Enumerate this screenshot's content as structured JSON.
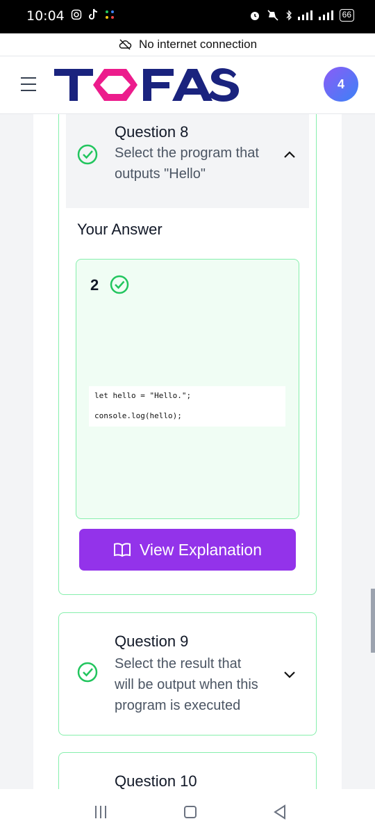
{
  "status_bar": {
    "time": "10:04",
    "battery": "66",
    "left_icons": [
      "instagram-icon",
      "tiktok-icon",
      "app-icon"
    ],
    "right_icons": [
      "alarm-icon",
      "mute-icon",
      "bluetooth-icon",
      "signal-icon",
      "signal-icon"
    ]
  },
  "offline_banner": {
    "text": "No internet connection",
    "icon": "cloud-off-icon"
  },
  "header": {
    "logo_text": "TOFAS",
    "avatar_count": "4",
    "colors": {
      "logo_navy": "#1a237e",
      "logo_pink": "#ec1c8c"
    }
  },
  "question8": {
    "title": "Question 8",
    "text_line1": "Select the program that",
    "text_line2": "outputs \"Hello\"",
    "status": "correct",
    "expanded": true
  },
  "answer": {
    "label": "Your Answer",
    "choice": "2",
    "code_line1": "let hello = \"Hello.\";",
    "code_line2": "console.log(hello);"
  },
  "explain_button": {
    "label": "View Explanation",
    "icon": "book-icon"
  },
  "question9": {
    "title": "Question 9",
    "text_line1": "Select the result that",
    "text_line2": "will be output when this",
    "text_line3": "program is executed",
    "status": "correct",
    "expanded": false
  },
  "question10": {
    "title": "Question 10"
  },
  "colors": {
    "success": "#22c55e",
    "accent": "#9333ea",
    "card_border": "#86efac"
  }
}
